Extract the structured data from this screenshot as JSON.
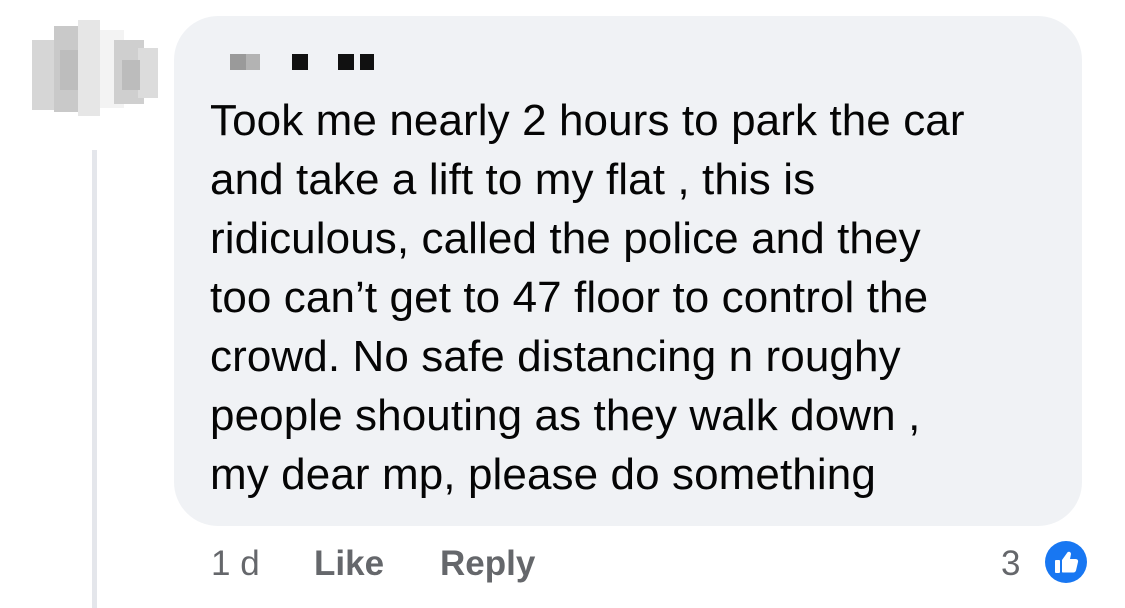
{
  "comment": {
    "author_redacted": "",
    "lines": [
      "Took me nearly 2 hours to park the car",
      "and take a lift to my flat , this is",
      "ridiculous, called the police and they",
      "too can’t get to 47 floor to control the",
      "crowd. No safe distancing n roughy",
      "people shouting as they walk down ,",
      "my dear mp, please do something"
    ]
  },
  "actions": {
    "timestamp": "1 d",
    "like_label": "Like",
    "reply_label": "Reply",
    "reaction_count": "3",
    "reaction_icon": "thumbs-up-icon"
  },
  "colors": {
    "bubble_bg": "#f0f2f5",
    "text": "#050505",
    "meta_text": "#65676b",
    "like_blue": "#1877f2",
    "thread_line": "#e4e6eb"
  }
}
